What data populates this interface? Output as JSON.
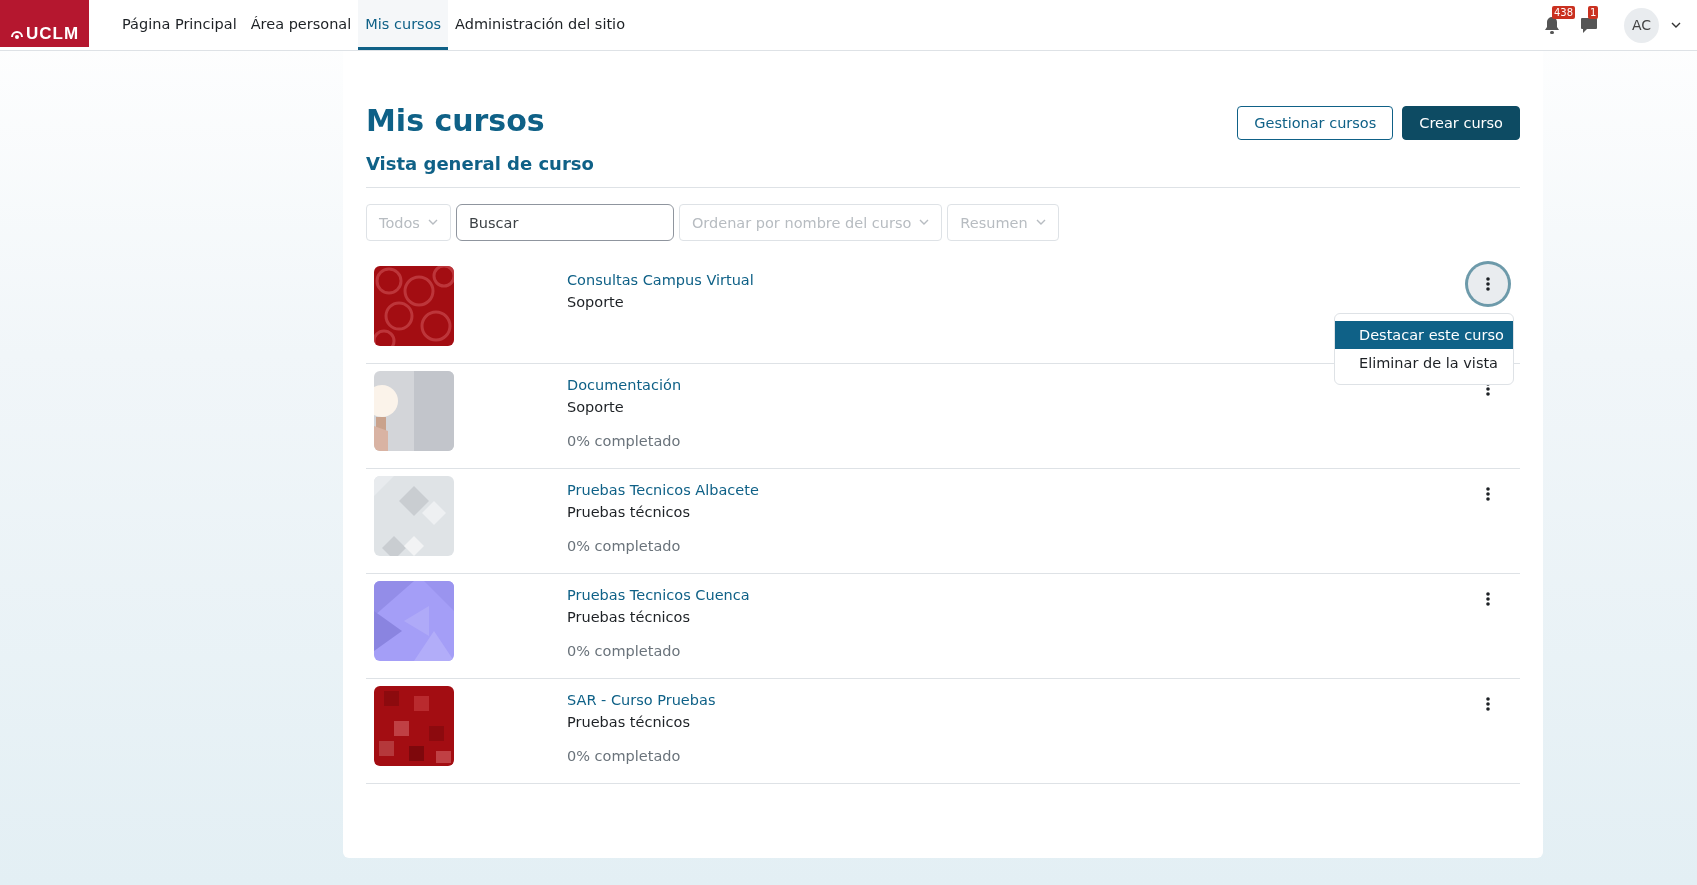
{
  "nav": {
    "logo": "UCLM",
    "items": [
      {
        "label": "Página Principal",
        "selected": false
      },
      {
        "label": "Área personal",
        "selected": false
      },
      {
        "label": "Mis cursos",
        "selected": true
      },
      {
        "label": "Administración del sitio",
        "selected": false
      }
    ],
    "notifications": "438",
    "messages": "1",
    "avatar": "AC"
  },
  "page": {
    "title": "Mis cursos",
    "subtitle": "Vista general de curso",
    "buttons": [
      {
        "label": "Gestionar cursos",
        "kind": "outline"
      },
      {
        "label": "Crear curso",
        "kind": "primary"
      }
    ]
  },
  "filters": {
    "grouping": {
      "label": "Todos",
      "disabled": true
    },
    "search": {
      "placeholder": "Buscar"
    },
    "sort": {
      "label": "Ordenar por nombre del curso",
      "disabled": true
    },
    "view": {
      "label": "Resumen",
      "disabled": true
    }
  },
  "courses": [
    {
      "name": "Consultas Campus Virtual",
      "category": "Soporte",
      "menu_open": true
    },
    {
      "name": "Documentación",
      "category": "Soporte",
      "progress": "0% completado",
      "menu_open": false
    },
    {
      "name": "Pruebas Tecnicos Albacete",
      "category": "Pruebas técnicos",
      "progress": "0% completado",
      "menu_open": false
    },
    {
      "name": "Pruebas Tecnicos Cuenca",
      "category": "Pruebas técnicos",
      "progress": "0% completado",
      "menu_open": false
    },
    {
      "name": "SAR - Curso Pruebas",
      "category": "Pruebas técnicos",
      "progress": "0% completado",
      "menu_open": false
    }
  ],
  "course_menu": {
    "items": [
      {
        "label": "Destacar este curso",
        "selected": true
      },
      {
        "label": "Eliminar de la vista",
        "selected": false
      }
    ]
  }
}
